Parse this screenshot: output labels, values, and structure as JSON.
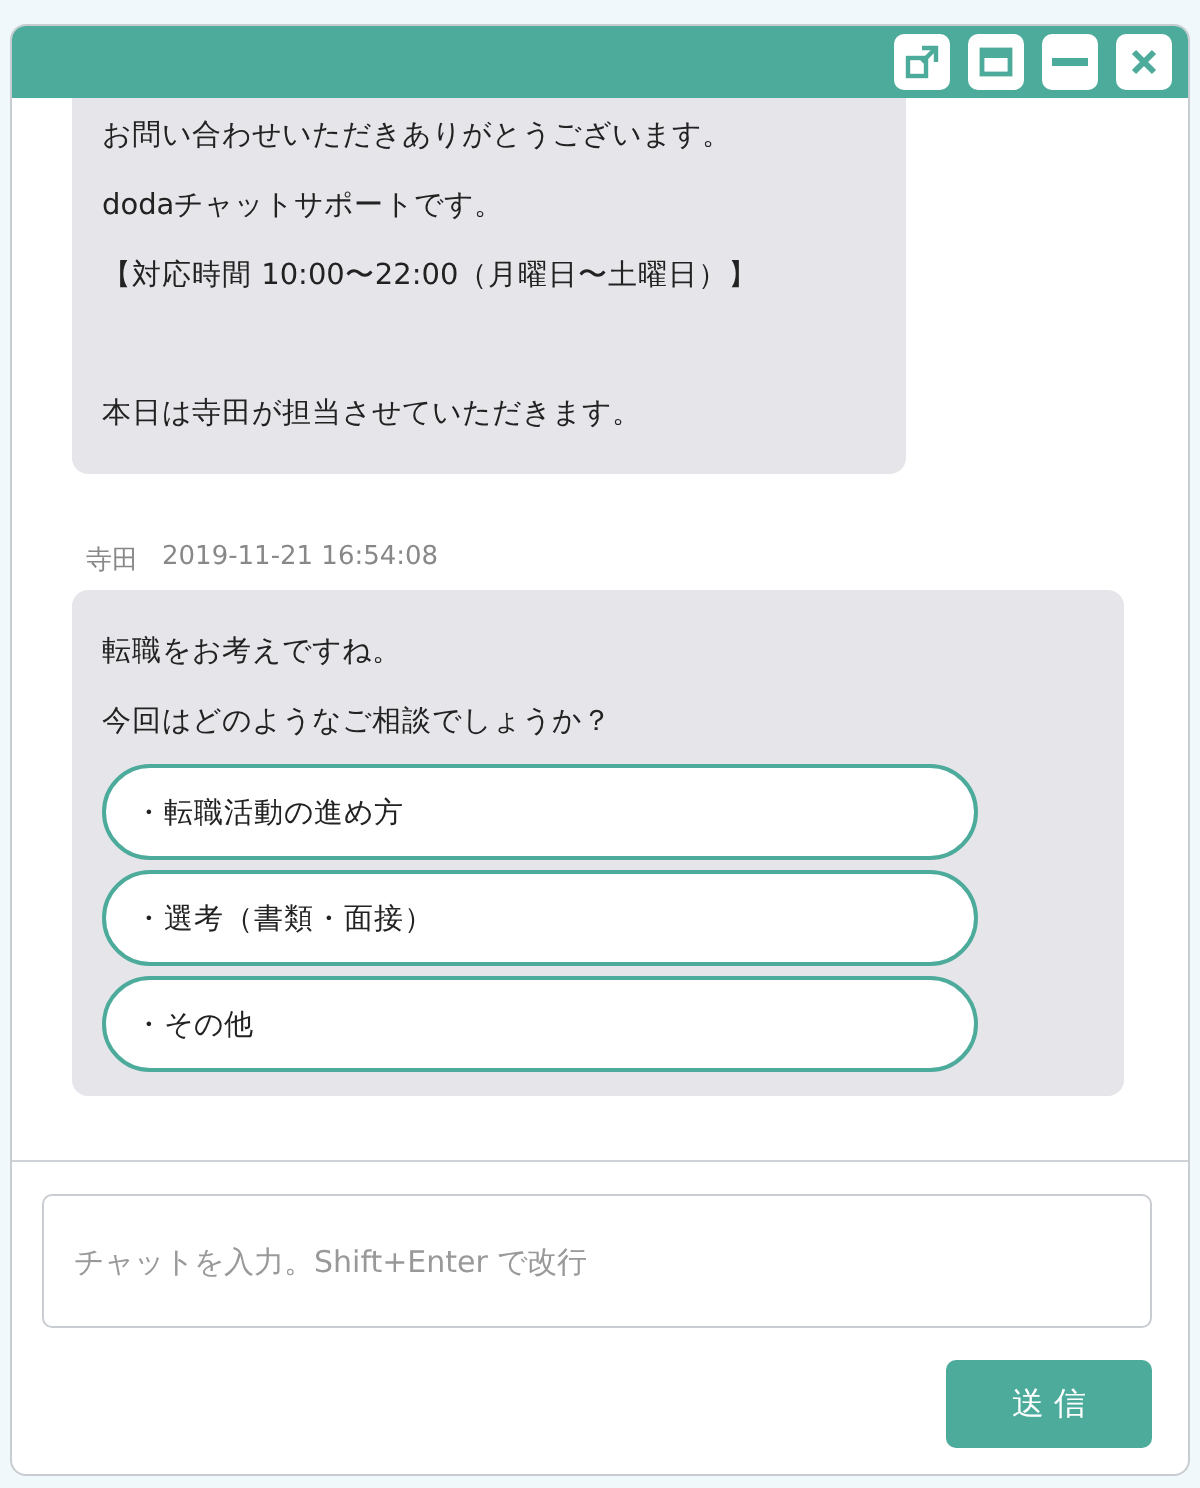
{
  "window": {
    "buttons": [
      {
        "kind": "popout"
      },
      {
        "kind": "restore"
      },
      {
        "kind": "minimize"
      },
      {
        "kind": "close"
      }
    ]
  },
  "messages": [
    {
      "paragraphs": [
        [
          "お問い合わせいただきありがとうございます。",
          "dodaチャットサポートです。",
          "【対応時間 10:00〜22:00（月曜日〜土曜日）】"
        ],
        [
          "本日は寺田が担当させていただきます。"
        ]
      ]
    },
    {
      "sender": "寺田",
      "time": "2019-11-21 16:54:08",
      "paragraphs": [
        [
          "転職をお考えですね。",
          "今回はどのようなご相談でしょうか？"
        ]
      ],
      "options": [
        "・転職活動の進め方",
        "・選考（書類・面接）",
        "・その他"
      ]
    }
  ],
  "composer": {
    "placeholder": "チャットを入力。Shift+Enter で改行",
    "send": "送 信"
  }
}
